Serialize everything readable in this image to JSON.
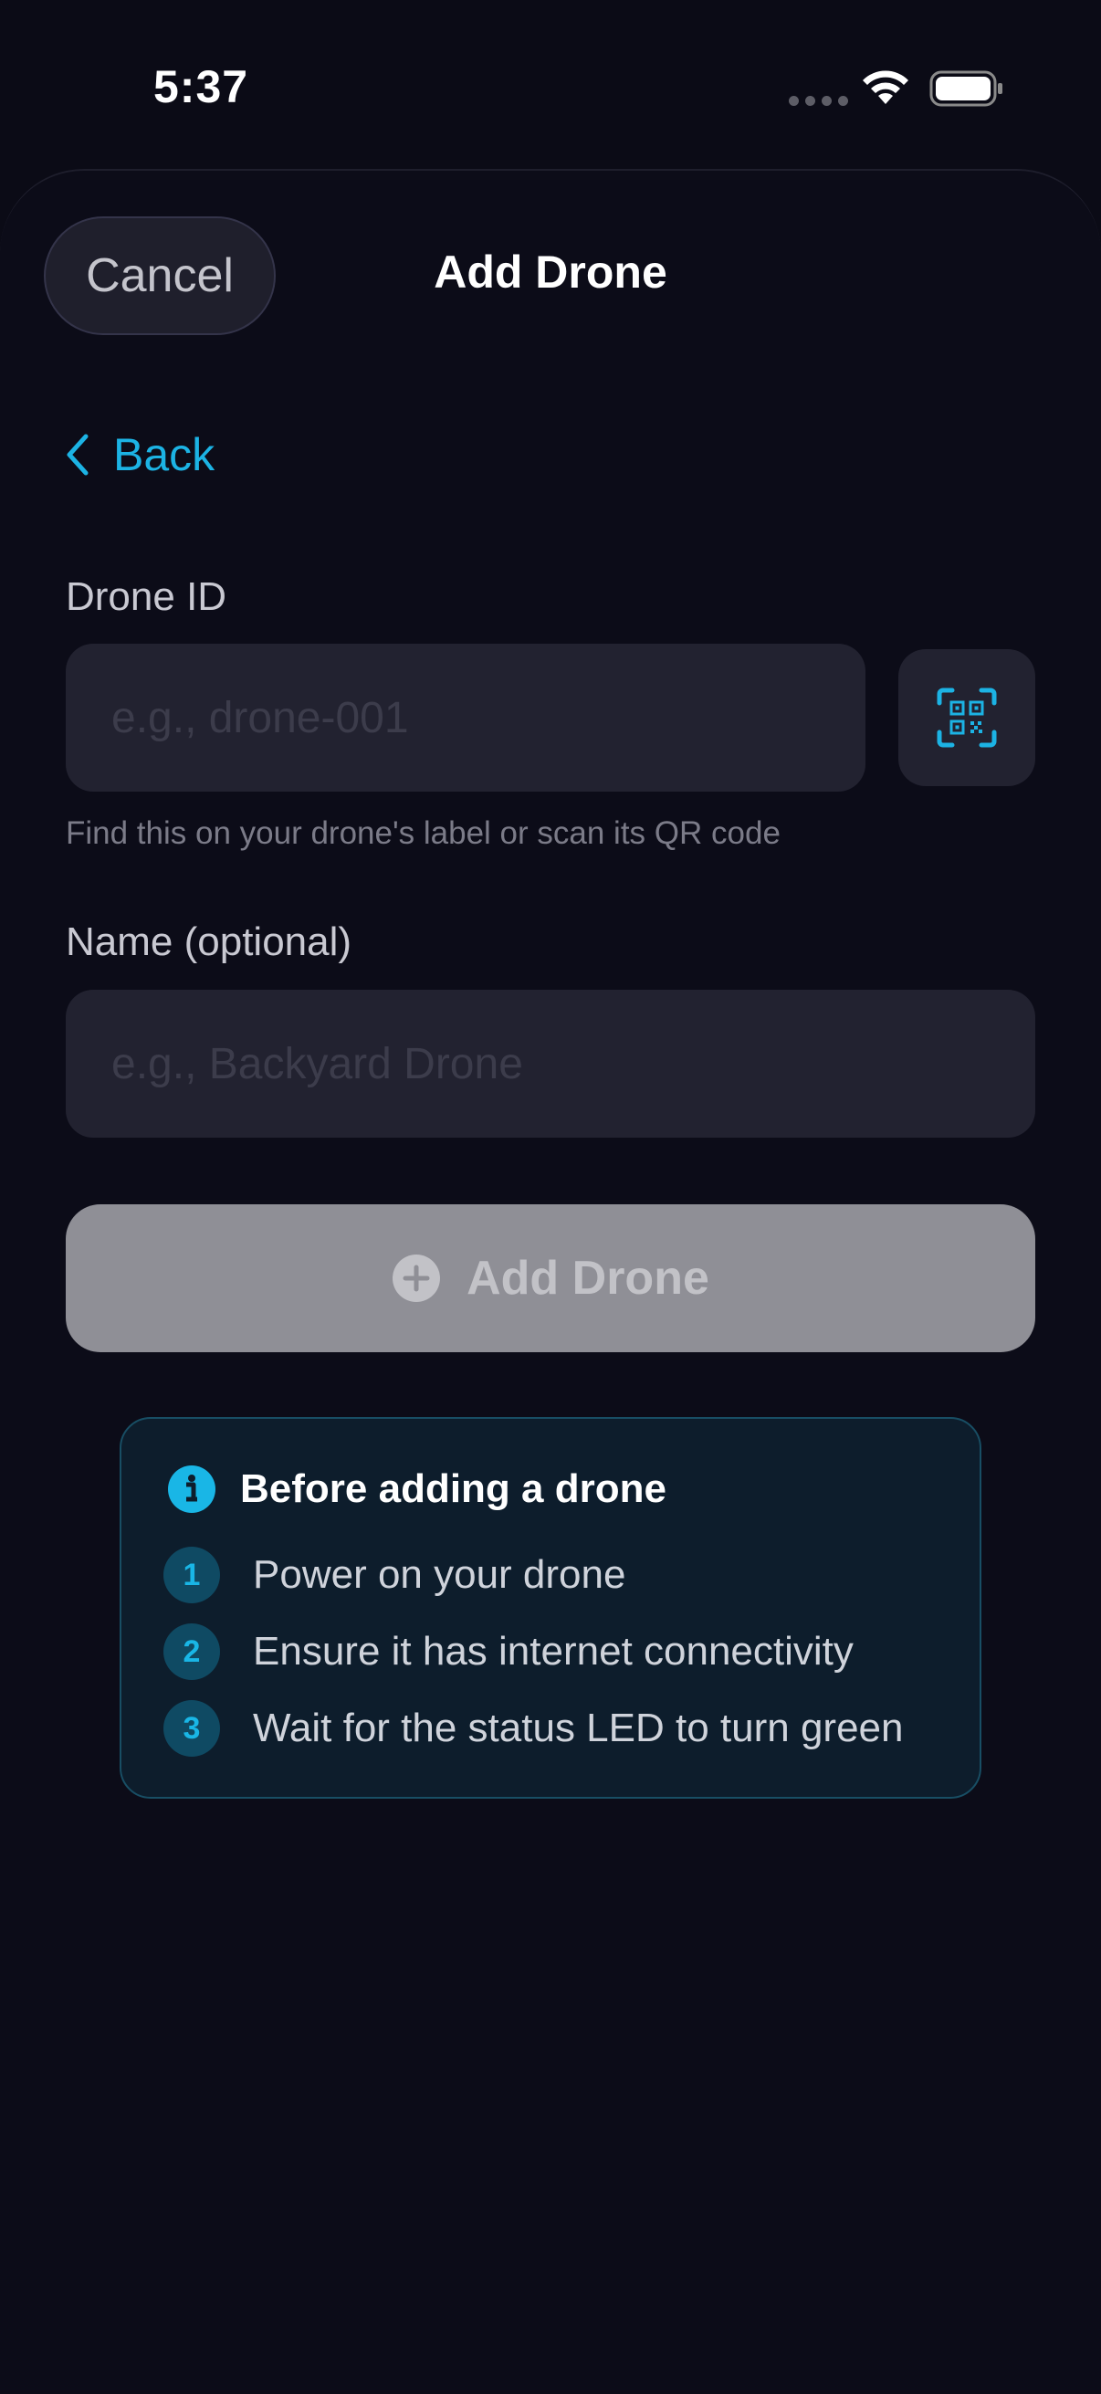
{
  "status_bar": {
    "time": "5:37"
  },
  "header": {
    "cancel_label": "Cancel",
    "title": "Add Drone"
  },
  "nav": {
    "back_label": "Back"
  },
  "form": {
    "drone_id": {
      "label": "Drone ID",
      "placeholder": "e.g., drone-001",
      "value": "",
      "helper": "Find this on your drone's label or scan its QR code"
    },
    "name": {
      "label": "Name (optional)",
      "placeholder": "e.g., Backyard Drone",
      "value": ""
    },
    "submit_label": "Add Drone"
  },
  "info": {
    "title": "Before adding a drone",
    "steps": [
      {
        "number": "1",
        "text": "Power on your drone"
      },
      {
        "number": "2",
        "text": "Ensure it has internet connectivity"
      },
      {
        "number": "3",
        "text": "Wait for the status LED to turn green"
      }
    ]
  },
  "icons": {
    "signal": "cellular-signal-icon",
    "wifi": "wifi-icon",
    "battery": "battery-icon",
    "back": "chevron-left-icon",
    "scan": "qr-scan-icon",
    "add": "plus-circle-icon",
    "info": "info-circle-icon"
  },
  "colors": {
    "background": "#0b0b16",
    "accent": "#1cb3e4",
    "input_bg": "#222230",
    "button_disabled": "#8f8f96",
    "info_card_bg": "#0d1d2c",
    "info_card_border": "#184e64"
  }
}
